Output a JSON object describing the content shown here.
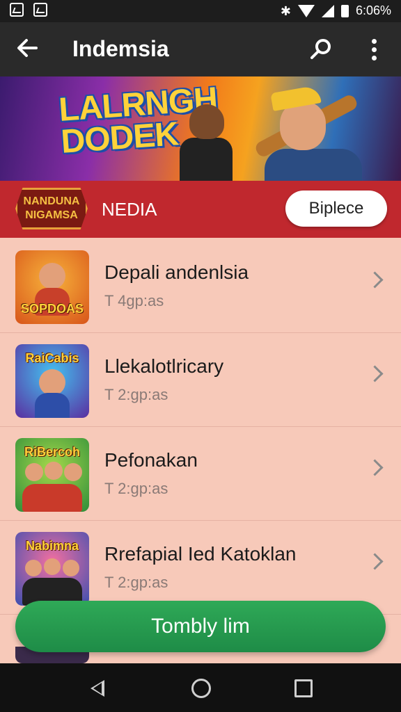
{
  "status_bar": {
    "right_text": "6:06%"
  },
  "app_bar": {
    "title": "Indemsia",
    "back_icon": "arrow-left-icon",
    "search_icon": "search-icon",
    "more_icon": "more-vertical-icon"
  },
  "banner": {
    "title_line1": "LALRNGH",
    "title_line2": "DODEK"
  },
  "promo_bar": {
    "logo_text": "NANDUNA\nNIGAMSA",
    "label": "NEDIA",
    "button_label": "Biplece"
  },
  "list": {
    "items": [
      {
        "title": "Depali andenlsia",
        "subtitle": "T 4gp:as",
        "thumb_text": "SOPDOAS"
      },
      {
        "title": "Llekalotlricary",
        "subtitle": "T 2:gp:as",
        "thumb_text": "RaiCabis"
      },
      {
        "title": "Pefonakan",
        "subtitle": "T 2:gp:as",
        "thumb_text": "RiBercoh"
      },
      {
        "title": "Rrefapial Ied Katoklan",
        "subtitle": "T 2:gp:as",
        "thumb_text": "Nabimna"
      }
    ]
  },
  "bottom_button": {
    "label": "Tombly lim"
  },
  "colors": {
    "app_bar": "#2a2a2a",
    "promo_bar": "#c0282e",
    "list_background": "#f7c9b9",
    "primary_button": "#2fa957"
  }
}
